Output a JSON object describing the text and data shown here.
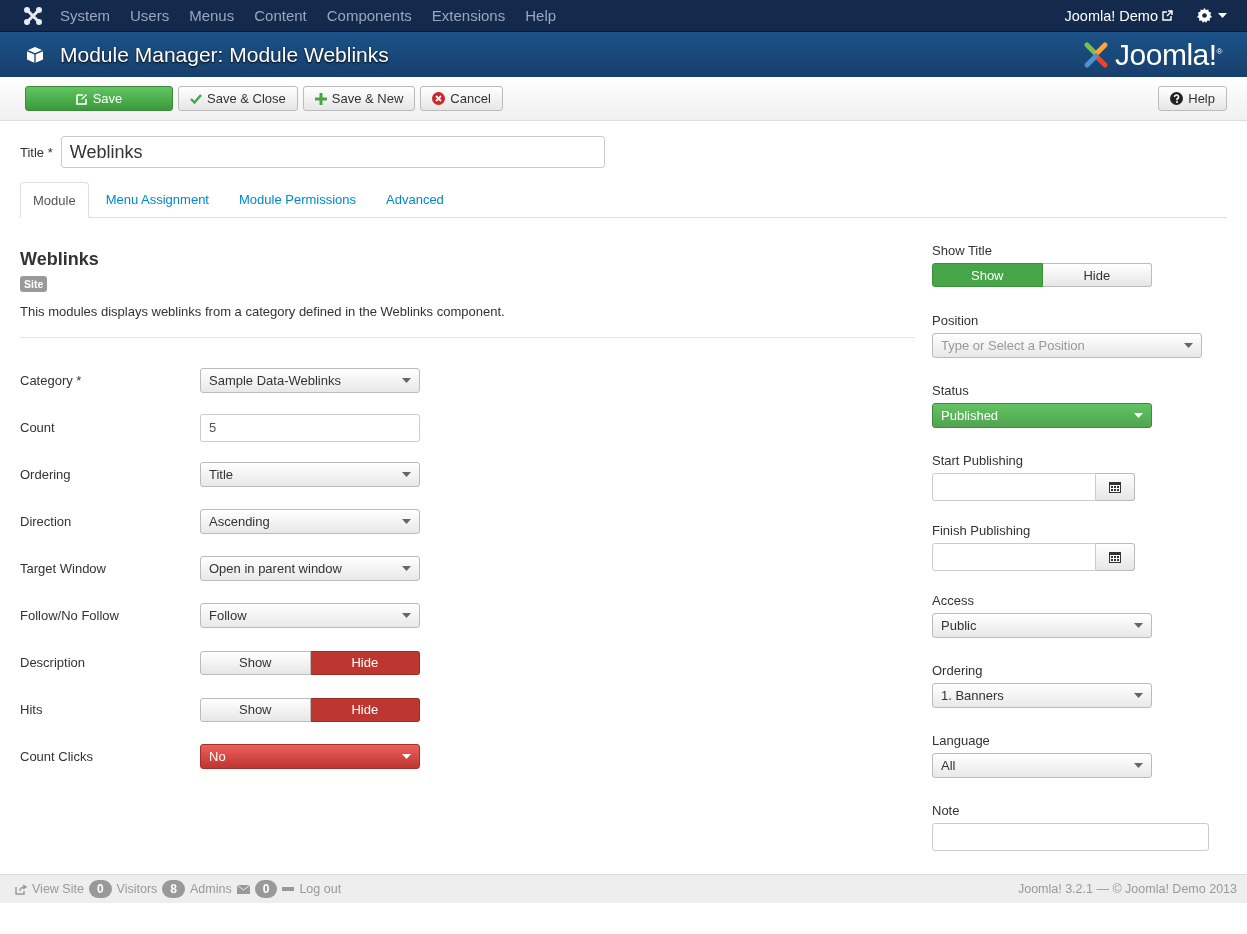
{
  "topnav": {
    "menu": [
      "System",
      "Users",
      "Menus",
      "Content",
      "Components",
      "Extensions",
      "Help"
    ],
    "site_link": "Joomla! Demo"
  },
  "header": {
    "title": "Module Manager: Module Weblinks",
    "logo_text": "Joomla!$^{®}$"
  },
  "toolbar": {
    "buttons": [
      {
        "label": "Save",
        "kind": "save"
      },
      {
        "label": "Save & Close",
        "kind": "check"
      },
      {
        "label": "Save & New",
        "kind": "new"
      },
      {
        "label": "Cancel",
        "kind": "cancel"
      }
    ],
    "help": "Help"
  },
  "title_field": {
    "label": "Title *",
    "value": "Weblinks"
  },
  "tabs": [
    {
      "label": "Module",
      "selected": true
    },
    {
      "label": "Menu Assignment",
      "selected": false
    },
    {
      "label": "Module Permissions",
      "selected": false
    },
    {
      "label": "Advanced",
      "selected": false
    }
  ],
  "module": {
    "heading": "Weblinks",
    "badge": "Site",
    "description": "This modules displays weblinks from a category defined in the Weblinks component."
  },
  "options": [
    {
      "label": "Category *",
      "kind": "select",
      "value": "Sample Data-Weblinks"
    },
    {
      "label": "Count",
      "kind": "text",
      "value": "5"
    },
    {
      "label": "Ordering",
      "kind": "select",
      "value": "Title"
    },
    {
      "label": "Direction",
      "kind": "select",
      "value": "Ascending"
    },
    {
      "label": "Target Window",
      "kind": "select",
      "value": "Open in parent window"
    },
    {
      "label": "Follow/No Follow",
      "kind": "select",
      "value": "Follow"
    },
    {
      "label": "Description",
      "kind": "toggle",
      "choices": [
        {
          "label": "Show",
          "selected": false
        },
        {
          "label": "Hide",
          "selected": true
        }
      ]
    },
    {
      "label": "Hits",
      "kind": "toggle",
      "choices": [
        {
          "label": "Show",
          "selected": false
        },
        {
          "label": "Hide",
          "selected": true
        }
      ]
    },
    {
      "label": "Count Clicks",
      "kind": "danger-select",
      "value": "No"
    }
  ],
  "sidebar": [
    {
      "label": "Show Title",
      "kind": "toggle",
      "choices": [
        {
          "label": "Show",
          "selected": true
        },
        {
          "label": "Hide",
          "selected": false
        }
      ]
    },
    {
      "label": "Position",
      "kind": "select",
      "placeholder": "Type or Select a Position"
    },
    {
      "label": "Status",
      "kind": "success-select",
      "value": "Published"
    },
    {
      "label": "Start Publishing",
      "kind": "date"
    },
    {
      "label": "Finish Publishing",
      "kind": "date"
    },
    {
      "label": "Access",
      "kind": "select",
      "value": "Public"
    },
    {
      "label": "Ordering",
      "kind": "select",
      "value": "1. Banners"
    },
    {
      "label": "Language",
      "kind": "select",
      "value": "All"
    },
    {
      "label": "Note",
      "kind": "text"
    }
  ],
  "status_bar": {
    "view_site": "View Site",
    "visitors_count": "0",
    "visitors": "Visitors",
    "admins_count": "8",
    "admins": "Admins",
    "messages_count": "0",
    "logout": "Log out",
    "version": "Joomla! 3.2.1 — © Joomla! Demo 2013"
  }
}
